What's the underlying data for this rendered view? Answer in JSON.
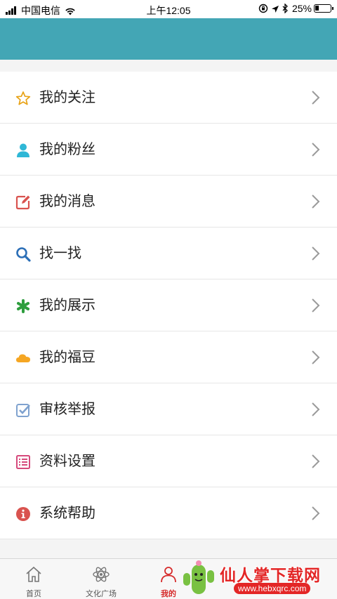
{
  "status_bar": {
    "carrier": "中国电信",
    "time": "上午12:05",
    "battery_percent": "25%",
    "battery_level": 0.25,
    "icons": [
      "signal-icon",
      "wifi-icon",
      "rotation-lock-icon",
      "location-icon",
      "bluetooth-icon",
      "battery-icon"
    ]
  },
  "header": {
    "background_color": "#43a6b5"
  },
  "menu": {
    "items": [
      {
        "label": "我的关注",
        "icon": "star-icon",
        "color": "#e8a317"
      },
      {
        "label": "我的粉丝",
        "icon": "user-icon",
        "color": "#2fb7d6"
      },
      {
        "label": "我的消息",
        "icon": "edit-message-icon",
        "color": "#d9534f"
      },
      {
        "label": "找一找",
        "icon": "search-icon",
        "color": "#2c6fb7"
      },
      {
        "label": "我的展示",
        "icon": "asterisk-icon",
        "color": "#2e9e3e"
      },
      {
        "label": "我的福豆",
        "icon": "cloud-icon",
        "color": "#f5a623"
      },
      {
        "label": "审核举报",
        "icon": "check-square-icon",
        "color": "#7fa2cf"
      },
      {
        "label": "资料设置",
        "icon": "list-icon",
        "color": "#d64a7c"
      },
      {
        "label": "系统帮助",
        "icon": "info-icon",
        "color": "#d9534f"
      }
    ]
  },
  "tab_bar": {
    "tabs": [
      {
        "label": "首页",
        "icon": "home-icon"
      },
      {
        "label": "文化广场",
        "icon": "atom-icon"
      },
      {
        "label": "我的",
        "icon": "person-icon",
        "active": true
      }
    ]
  },
  "watermark": {
    "text": "仙人掌下载网",
    "url": "www.hebxqrc.com"
  }
}
